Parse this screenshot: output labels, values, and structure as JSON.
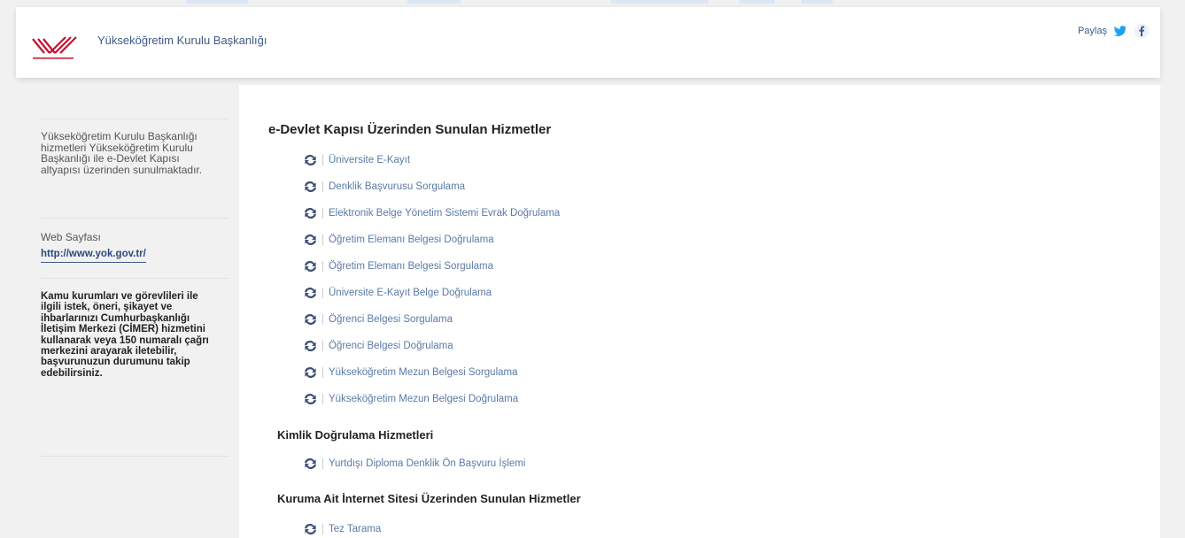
{
  "header": {
    "institution_name": "Yükseköğretim Kurulu Başkanlığı",
    "share_label": "Paylaş",
    "logo_icon": "yok-logo-icon",
    "social": [
      "twitter-icon",
      "facebook-icon"
    ]
  },
  "sidebar": {
    "description": "Yükseköğretim Kurulu Başkanlığı hizmetleri Yükseköğretim Kurulu Başkanlığı ile e-Devlet Kapısı altyapısı üzerinden sunulmaktadır.",
    "web_title": "Web Sayfası",
    "web_link": "http://www.yok.gov.tr/",
    "cimer_text": "Kamu kurumları ve görevlileri ile ilgili istek, öneri, şikayet ve ihbarlarınızı Cumhurbaşkanlığı İletişim Merkezi (CİMER) hizmetini kullanarak veya 150 numaralı çağrı merkezini arayarak iletebilir, başvurunuzun durumunu takip edebilirsiniz."
  },
  "main": {
    "sections": [
      {
        "title": "e-Devlet Kapısı Üzerinden Sunulan Hizmetler",
        "items": [
          "Üniversite E-Kayıt",
          "Denklik Başvurusu Sorgulama",
          "Elektronik Belge Yönetim Sistemi Evrak Doğrulama",
          "Öğretim Elemanı Belgesi Doğrulama",
          "Öğretim Elemanı Belgesi Sorgulama",
          "Üniversite E-Kayıt Belge Doğrulama",
          "Öğrenci Belgesi Sorgulama",
          "Öğrenci Belgesi Doğrulama",
          "Yükseköğretim Mezun Belgesi Sorgulama",
          "Yükseköğretim Mezun Belgesi Doğrulama"
        ]
      },
      {
        "title": "Kimlik Doğrulama Hizmetleri",
        "items": [
          "Yurtdışı Diploma Denklik Ön Başvuru İşlemi"
        ]
      },
      {
        "title": "Kuruma Ait İnternet Sitesi Üzerinden Sunulan Hizmetler",
        "items": [
          "Tez Tarama"
        ]
      }
    ],
    "item_icon": "refresh-arrows-icon"
  },
  "colors": {
    "link": "#5a7aa6",
    "brand_blue": "#3e5a88",
    "logo_red": "#c8102e",
    "twitter": "#1da1f2",
    "facebook": "#3b5998"
  }
}
